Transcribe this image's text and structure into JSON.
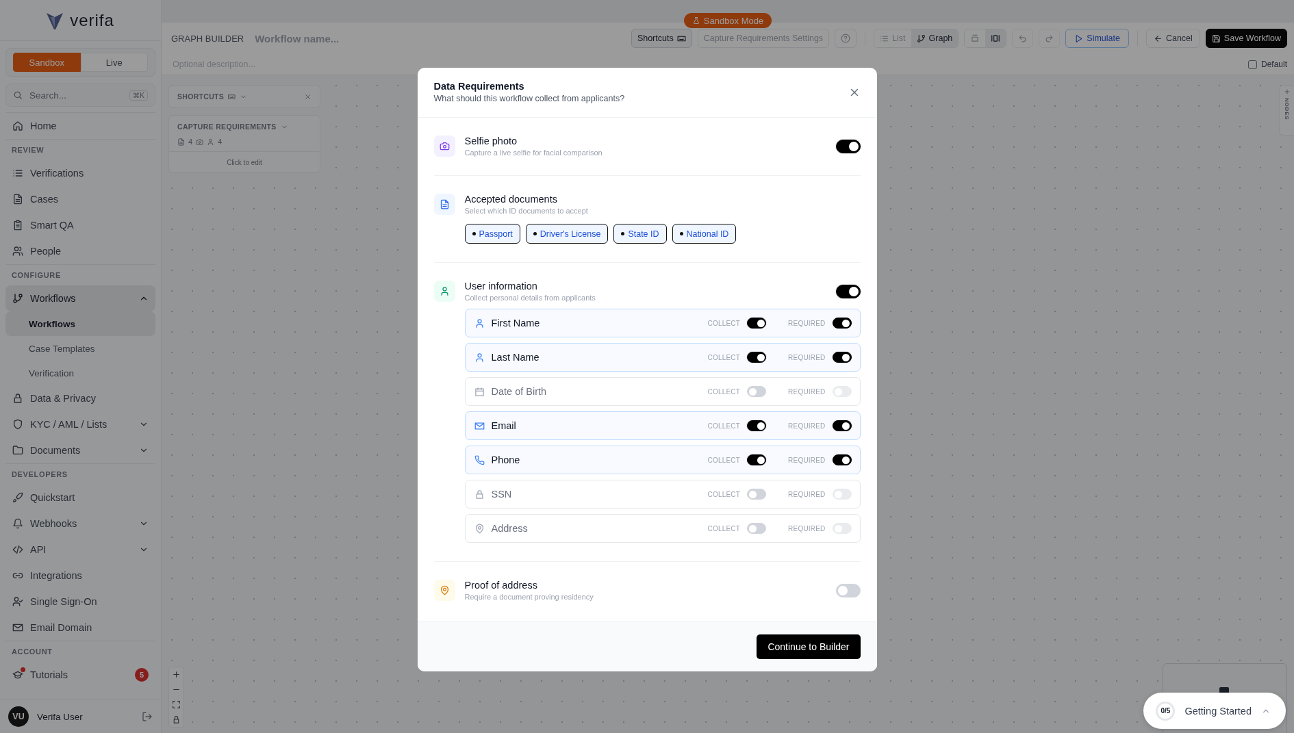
{
  "logo": {
    "text": "verifa"
  },
  "environment": [
    {
      "label": "Sandbox",
      "selected": true
    },
    {
      "label": "Live",
      "selected": false
    }
  ],
  "search": {
    "placeholder": "Search...",
    "shortcut": "⌘K"
  },
  "sidebar": {
    "sections": [
      {
        "items": [
          {
            "label": "Home",
            "selected": false
          }
        ]
      },
      {
        "heading": "REVIEW",
        "items": [
          {
            "label": "Verifications",
            "selected": false
          },
          {
            "label": "Cases",
            "selected": false
          },
          {
            "label": "Smart QA",
            "selected": false
          },
          {
            "label": "People",
            "selected": false
          }
        ]
      },
      {
        "heading": "CONFIGURE",
        "items": [
          {
            "label": "Workflows",
            "selected": true,
            "expanded": true,
            "children": [
              {
                "label": "Workflows",
                "selected": true
              },
              {
                "label": "Case Templates",
                "selected": false
              },
              {
                "label": "Verification",
                "selected": false
              }
            ]
          },
          {
            "label": "Data & Privacy",
            "selected": false
          },
          {
            "label": "KYC / AML / Lists",
            "selected": false,
            "expanded": false
          },
          {
            "label": "Documents",
            "selected": false,
            "expanded": false
          }
        ]
      },
      {
        "heading": "DEVELOPERS",
        "items": [
          {
            "label": "Quickstart",
            "selected": false
          },
          {
            "label": "Webhooks",
            "selected": false,
            "expanded": false
          },
          {
            "label": "API",
            "selected": false,
            "expanded": false
          },
          {
            "label": "Integrations",
            "selected": false
          },
          {
            "label": "Single Sign-On",
            "selected": false
          },
          {
            "label": "Email Domain",
            "selected": false
          }
        ]
      },
      {
        "heading": "ACCOUNT",
        "items": [
          {
            "label": "Tutorials",
            "selected": false,
            "badge": "5",
            "notification": true
          }
        ]
      }
    ]
  },
  "user": {
    "initials": "VU",
    "name": "Verifa User"
  },
  "mode_badge": "Sandbox Mode",
  "header": {
    "title": "GRAPH BUILDER",
    "name_placeholder": "Workflow name...",
    "description_placeholder": "Optional description...",
    "shortcuts_button": "Shortcuts",
    "settings_button": "Capture Requirements Settings",
    "views": [
      {
        "label": "List",
        "selected": false
      },
      {
        "label": "Graph",
        "selected": true
      }
    ],
    "layouts": [
      {
        "selected": false
      },
      {
        "selected": true
      }
    ],
    "undo_disabled": true,
    "redo_disabled": true,
    "simulate_button": "Simulate",
    "cancel_button": "Cancel",
    "save_button": "Save Workflow",
    "default_checkbox": {
      "label": "Default",
      "checked": false
    }
  },
  "canvas": {
    "shortcuts_panel": {
      "title": "SHORTCUTS",
      "expanded": false
    },
    "capture_card": {
      "title": "CAPTURE REQUIREMENTS",
      "documents": "4",
      "users": "4",
      "hint": "Click to edit"
    },
    "nodes_tab": "NODES"
  },
  "modal": {
    "title": "Data Requirements",
    "subtitle": "What should this workflow collect from applicants?",
    "sections": [
      {
        "kind": "toggle",
        "title": "Selfie photo",
        "description": "Capture a live selfie for facial comparison",
        "on": true
      },
      {
        "kind": "chips",
        "title": "Accepted documents",
        "description": "Select which ID documents to accept",
        "chips": [
          {
            "label": "Passport",
            "selected": true
          },
          {
            "label": "Driver's License",
            "selected": true
          },
          {
            "label": "State ID",
            "selected": true
          },
          {
            "label": "National ID",
            "selected": true
          }
        ]
      },
      {
        "kind": "fields",
        "title": "User information",
        "description": "Collect personal details from applicants",
        "on": true,
        "fields": [
          {
            "label": "First Name",
            "collect_label": "COLLECT",
            "collect": true,
            "required_label": "REQUIRED",
            "required": true
          },
          {
            "label": "Last Name",
            "collect_label": "COLLECT",
            "collect": true,
            "required_label": "REQUIRED",
            "required": true
          },
          {
            "label": "Date of Birth",
            "collect_label": "COLLECT",
            "collect": false,
            "required_label": "REQUIRED",
            "required": false
          },
          {
            "label": "Email",
            "collect_label": "COLLECT",
            "collect": true,
            "required_label": "REQUIRED",
            "required": true
          },
          {
            "label": "Phone",
            "collect_label": "COLLECT",
            "collect": true,
            "required_label": "REQUIRED",
            "required": true
          },
          {
            "label": "SSN",
            "collect_label": "COLLECT",
            "collect": false,
            "required_label": "REQUIRED",
            "required": false
          },
          {
            "label": "Address",
            "collect_label": "COLLECT",
            "collect": false,
            "required_label": "REQUIRED",
            "required": false
          }
        ]
      },
      {
        "kind": "toggle",
        "title": "Proof of address",
        "description": "Require a document proving residency",
        "on": false
      }
    ],
    "continue_button": "Continue to Builder"
  },
  "getting_started": {
    "progress": "0/5",
    "label": "Getting Started"
  }
}
